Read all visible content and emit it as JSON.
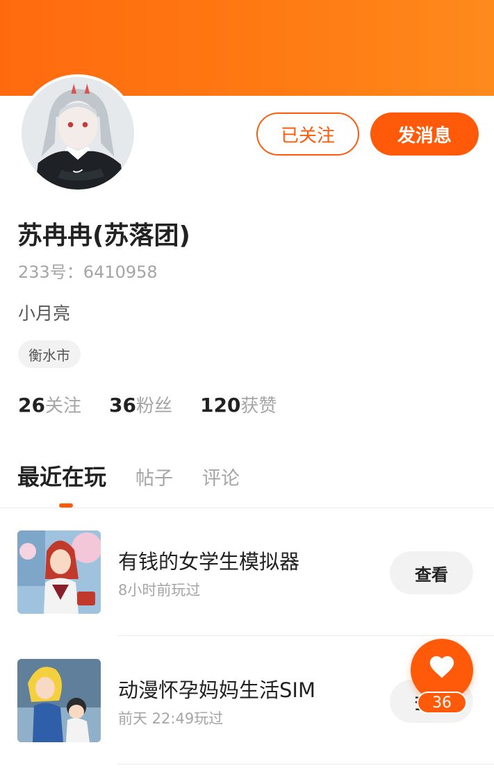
{
  "profile": {
    "name": "苏冉冉(苏落团)",
    "id_text": "233号：6410958",
    "bio": "小月亮",
    "location": "衡水市"
  },
  "actions": {
    "follow_label": "已关注",
    "message_label": "发消息"
  },
  "stats": [
    {
      "count": "26",
      "label": "关注"
    },
    {
      "count": "36",
      "label": "粉丝"
    },
    {
      "count": "120",
      "label": "获赞"
    }
  ],
  "tabs": [
    "最近在玩",
    "帖子",
    "评论"
  ],
  "active_tab": "最近在玩",
  "games": [
    {
      "title": "有钱的女学生模拟器",
      "time": "8小时前玩过",
      "action": "查看"
    },
    {
      "title": "动漫怀孕妈妈生活SIM",
      "time": "前天 22:49玩过",
      "action": "查看"
    }
  ],
  "like": {
    "count": "36",
    "icon": "heart-icon"
  },
  "colors": {
    "accent": "#ff5a0a",
    "banner": "#ff7a12"
  }
}
